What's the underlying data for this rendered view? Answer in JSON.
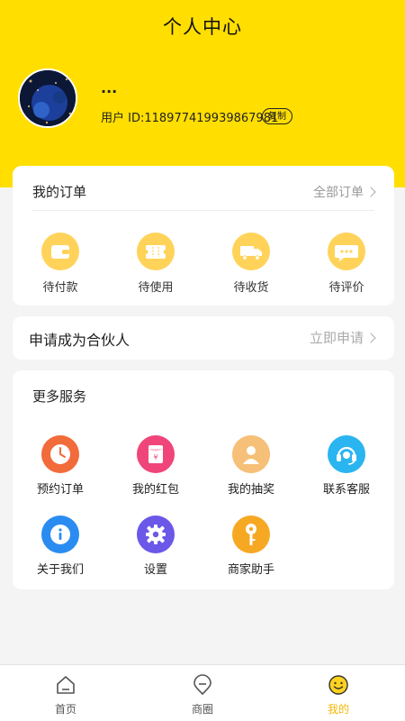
{
  "header": {
    "title": "个人中心"
  },
  "profile": {
    "nickname": "...",
    "user_id": "用户 ID:118977419939867981",
    "copy_label": "复制"
  },
  "orders": {
    "title": "我的订单",
    "all_label": "全部订单",
    "items": [
      {
        "label": "待付款",
        "icon": "wallet-icon"
      },
      {
        "label": "待使用",
        "icon": "ticket-icon"
      },
      {
        "label": "待收货",
        "icon": "truck-icon"
      },
      {
        "label": "待评价",
        "icon": "comment-icon"
      }
    ]
  },
  "partner": {
    "title": "申请成为合伙人",
    "apply_label": "立即申请"
  },
  "services": {
    "title": "更多服务",
    "items": [
      {
        "label": "预约订单",
        "icon": "clock-icon",
        "color": "#f26b3a"
      },
      {
        "label": "我的红包",
        "icon": "red-packet-icon",
        "color": "#f0457a"
      },
      {
        "label": "我的抽奖",
        "icon": "lottery-icon",
        "color": "#f4b35e"
      },
      {
        "label": "联系客服",
        "icon": "headset-icon",
        "color": "#2bb5f0"
      },
      {
        "label": "关于我们",
        "icon": "info-icon",
        "color": "#2a8cf0"
      },
      {
        "label": "设置",
        "icon": "settings-icon",
        "color": "#6b57e8"
      },
      {
        "label": "商家助手",
        "icon": "key-icon",
        "color": "#f7a823"
      }
    ]
  },
  "tabbar": {
    "items": [
      {
        "label": "首页",
        "icon": "home-icon"
      },
      {
        "label": "商圈",
        "icon": "location-icon"
      },
      {
        "label": "我的",
        "icon": "smiley-icon"
      }
    ],
    "active_color": "#f2b705"
  },
  "colors": {
    "brand_yellow": "#ffde00",
    "order_icon_bg": "#ffd35a"
  }
}
